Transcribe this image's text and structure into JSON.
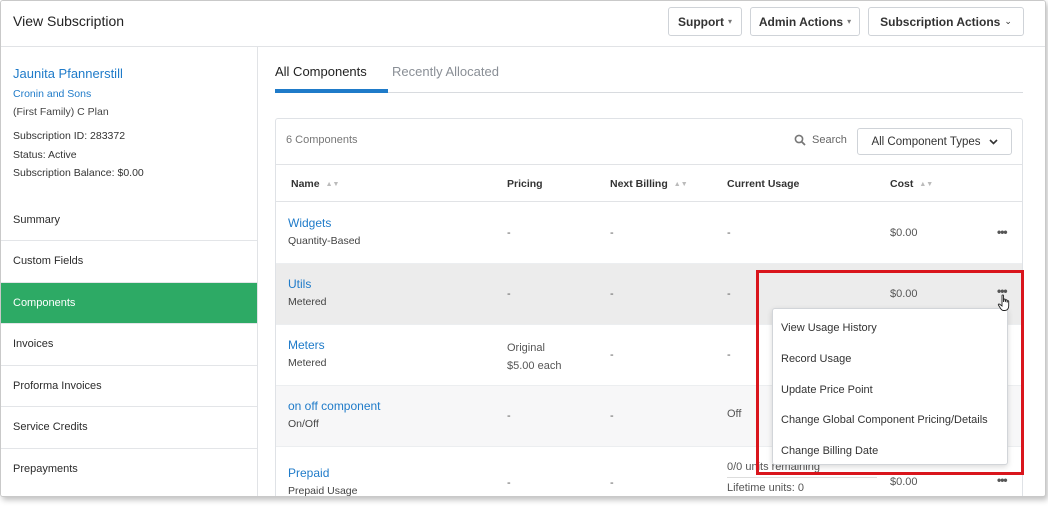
{
  "header": {
    "title": "View Subscription",
    "buttons": {
      "support": "Support",
      "admin_actions": "Admin Actions",
      "subscription_actions": "Subscription Actions"
    }
  },
  "sidebar": {
    "customer_name": "Jaunita Pfannerstill",
    "organization": "Cronin and Sons",
    "plan": "(First Family) C Plan",
    "subscription_id": "Subscription ID: 283372",
    "status": "Status: Active",
    "balance": "Subscription Balance: $0.00",
    "nav": [
      "Summary",
      "Custom Fields",
      "Components",
      "Invoices",
      "Proforma Invoices",
      "Service Credits",
      "Prepayments"
    ],
    "active_nav": "Components"
  },
  "tabs": [
    "All Components",
    "Recently Allocated"
  ],
  "components": {
    "count": "6 Components",
    "search_label": "Search",
    "type_filter": "All Component Types",
    "columns": [
      "Name",
      "Pricing",
      "Next Billing",
      "Current Usage",
      "Cost"
    ],
    "rows": [
      {
        "name": "Widgets",
        "type": "Quantity-Based",
        "pricing": "-",
        "next_billing": "-",
        "usage": "-",
        "cost": "$0.00"
      },
      {
        "name": "Utils",
        "type": "Metered",
        "pricing": "-",
        "next_billing": "-",
        "usage": "-",
        "cost": "$0.00"
      },
      {
        "name": "Meters",
        "type": "Metered",
        "pricing": "Original",
        "pricing_detail": "$5.00 each",
        "next_billing": "-",
        "usage": "-",
        "cost": ""
      },
      {
        "name": "on off component",
        "type": "On/Off",
        "pricing": "-",
        "next_billing": "-",
        "usage": "Off",
        "cost": ""
      },
      {
        "name": "Prepaid",
        "type": "Prepaid Usage",
        "pricing": "-",
        "next_billing": "-",
        "usage": "0/0 units remaining",
        "usage_detail": "Lifetime units: 0",
        "cost": "$0.00"
      }
    ],
    "more_icon": "•••"
  },
  "dropdown": {
    "items": [
      "View Usage History",
      "Record Usage",
      "Update Price Point",
      "Change Global Component Pricing/Details",
      "Change Billing Date"
    ]
  },
  "colors": {
    "accent": "#1f7bc9",
    "active_nav": "#2daa65",
    "highlight_box": "#d9151c"
  }
}
